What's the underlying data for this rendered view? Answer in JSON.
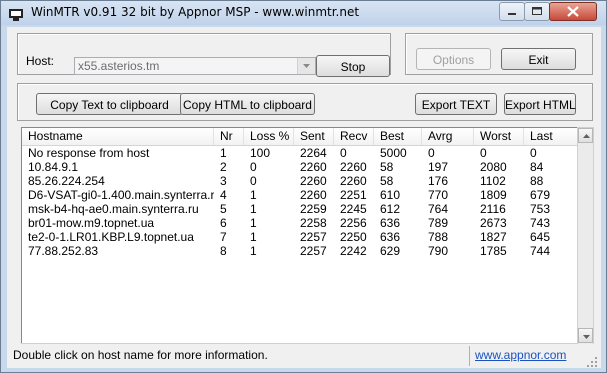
{
  "window": {
    "title": "WinMTR v0.91 32 bit by Appnor MSP - www.winmtr.net"
  },
  "host": {
    "label": "Host:",
    "value": "x55.asterios.tm"
  },
  "buttons": {
    "stop": "Stop",
    "options": "Options",
    "exit": "Exit",
    "copy_text": "Copy Text to clipboard",
    "copy_html": "Copy HTML to clipboard",
    "export_text": "Export TEXT",
    "export_html": "Export HTML"
  },
  "table": {
    "columns": [
      "Hostname",
      "Nr",
      "Loss %",
      "Sent",
      "Recv",
      "Best",
      "Avrg",
      "Worst",
      "Last"
    ],
    "rows": [
      [
        "No response from host",
        "1",
        "100",
        "2264",
        "0",
        "5000",
        "0",
        "0",
        "0"
      ],
      [
        "10.84.9.1",
        "2",
        "0",
        "2260",
        "2260",
        "58",
        "197",
        "2080",
        "84"
      ],
      [
        "85.26.224.254",
        "3",
        "0",
        "2260",
        "2260",
        "58",
        "176",
        "1102",
        "88"
      ],
      [
        "D6-VSAT-gi0-1.400.main.synterra.ru",
        "4",
        "1",
        "2260",
        "2251",
        "610",
        "770",
        "1809",
        "679"
      ],
      [
        "msk-b4-hq-ae0.main.synterra.ru",
        "5",
        "1",
        "2259",
        "2245",
        "612",
        "764",
        "2116",
        "753"
      ],
      [
        "br01-mow.m9.topnet.ua",
        "6",
        "1",
        "2258",
        "2256",
        "636",
        "789",
        "2673",
        "743"
      ],
      [
        "te2-0-1.LR01.KBP.L9.topnet.ua",
        "7",
        "1",
        "2257",
        "2250",
        "636",
        "788",
        "1827",
        "645"
      ],
      [
        "77.88.252.83",
        "8",
        "1",
        "2257",
        "2242",
        "629",
        "790",
        "1785",
        "744"
      ]
    ]
  },
  "status": {
    "text": "Double click on host name for more information.",
    "link": "www.appnor.com"
  },
  "icons": {
    "app": "network-monitor-icon",
    "minimize": "minimize-icon",
    "maximize": "maximize-icon",
    "close": "close-icon"
  },
  "colors": {
    "title_bar": "#c9d9ec",
    "close_button": "#c8493a",
    "link": "#1a53c1"
  }
}
